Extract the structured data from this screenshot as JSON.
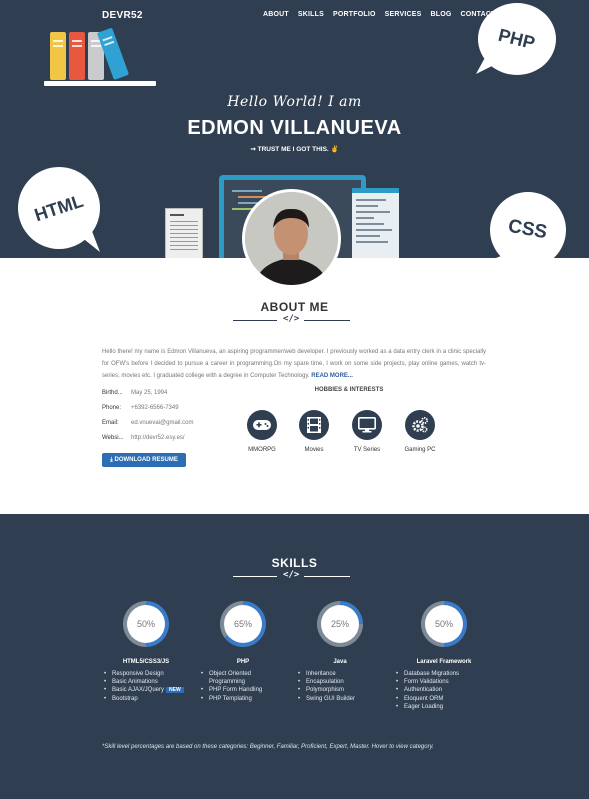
{
  "nav": {
    "brand": "DEVR52",
    "items": [
      "ABOUT",
      "SKILLS",
      "PORTFOLIO",
      "SERVICES",
      "BLOG",
      "CONTACT"
    ]
  },
  "hero": {
    "hello": "Hello World! I am",
    "name": "EDMON VILLANUEVA",
    "tagline": "⇝ TRUST ME I GOT THIS. ✌",
    "bubbles": {
      "php": "PHP",
      "html": "HTML",
      "css": "CSS"
    }
  },
  "about": {
    "title": "ABOUT ME",
    "code_icon": "</>",
    "text": "Hello there! my name is Edmon Villanueva, an aspiring programmer/web developer. I previously worked as a data entry clerk in a clinic specially for OFW's before I decided to pursue a career in programming.On my spare time, I work on some side projects, play online games, watch tv-series, movies etc. I graduated college with a degree in Computer Technology.",
    "read_more": "READ MORE...",
    "info": [
      {
        "key": "Birthd...",
        "value": "May 25, 1994"
      },
      {
        "key": "Phone:",
        "value": "+6392-6566-7349"
      },
      {
        "key": "Email:",
        "value": "ed.vnuevai@gmail.com"
      },
      {
        "key": "Websi...",
        "value": "http://devr52.esy.es/"
      }
    ],
    "download_label": "⤓ DOWNLOAD RESUME",
    "hobbies_title": "HOBBIES & INTERESTS",
    "hobbies": [
      {
        "label": "MMORPG",
        "icon": "gamepad-icon"
      },
      {
        "label": "Movies",
        "icon": "film-icon"
      },
      {
        "label": "TV Series",
        "icon": "tv-icon"
      },
      {
        "label": "Gaming PC",
        "icon": "cogs-icon"
      }
    ]
  },
  "skills": {
    "title": "SKILLS",
    "code_icon": "</>",
    "groups": [
      {
        "name": "HTML5/CSS3/JS",
        "percent": "50%",
        "level": 0.5,
        "items": [
          "Responsive Design",
          "Basic Animations",
          "Basic AJAX/JQuery",
          "Bootstrap"
        ],
        "new_badge": "NEW"
      },
      {
        "name": "PHP",
        "percent": "65%",
        "level": 0.65,
        "items": [
          "Object Oriented Programming",
          "PHP Form Handling",
          "PHP Templating"
        ]
      },
      {
        "name": "Java",
        "percent": "25%",
        "level": 0.25,
        "items": [
          "Inheritance",
          "Encapsulation",
          "Polymorphism",
          "Swing GUI Builder"
        ]
      },
      {
        "name": "Laravel Framework",
        "percent": "50%",
        "level": 0.5,
        "items": [
          "Database Migrations",
          "Form Validations",
          "Authentication",
          "Eloquent ORM",
          "Eager Loading"
        ]
      }
    ],
    "note": "*Skill level percentages are based on these categories: Beginner, Familiar, Proficient, Expert, Master. Hover to view category."
  },
  "colors": {
    "navy": "#2f3e50",
    "accent_blue": "#2d6db3",
    "ring_blue": "#3a7bc8"
  }
}
